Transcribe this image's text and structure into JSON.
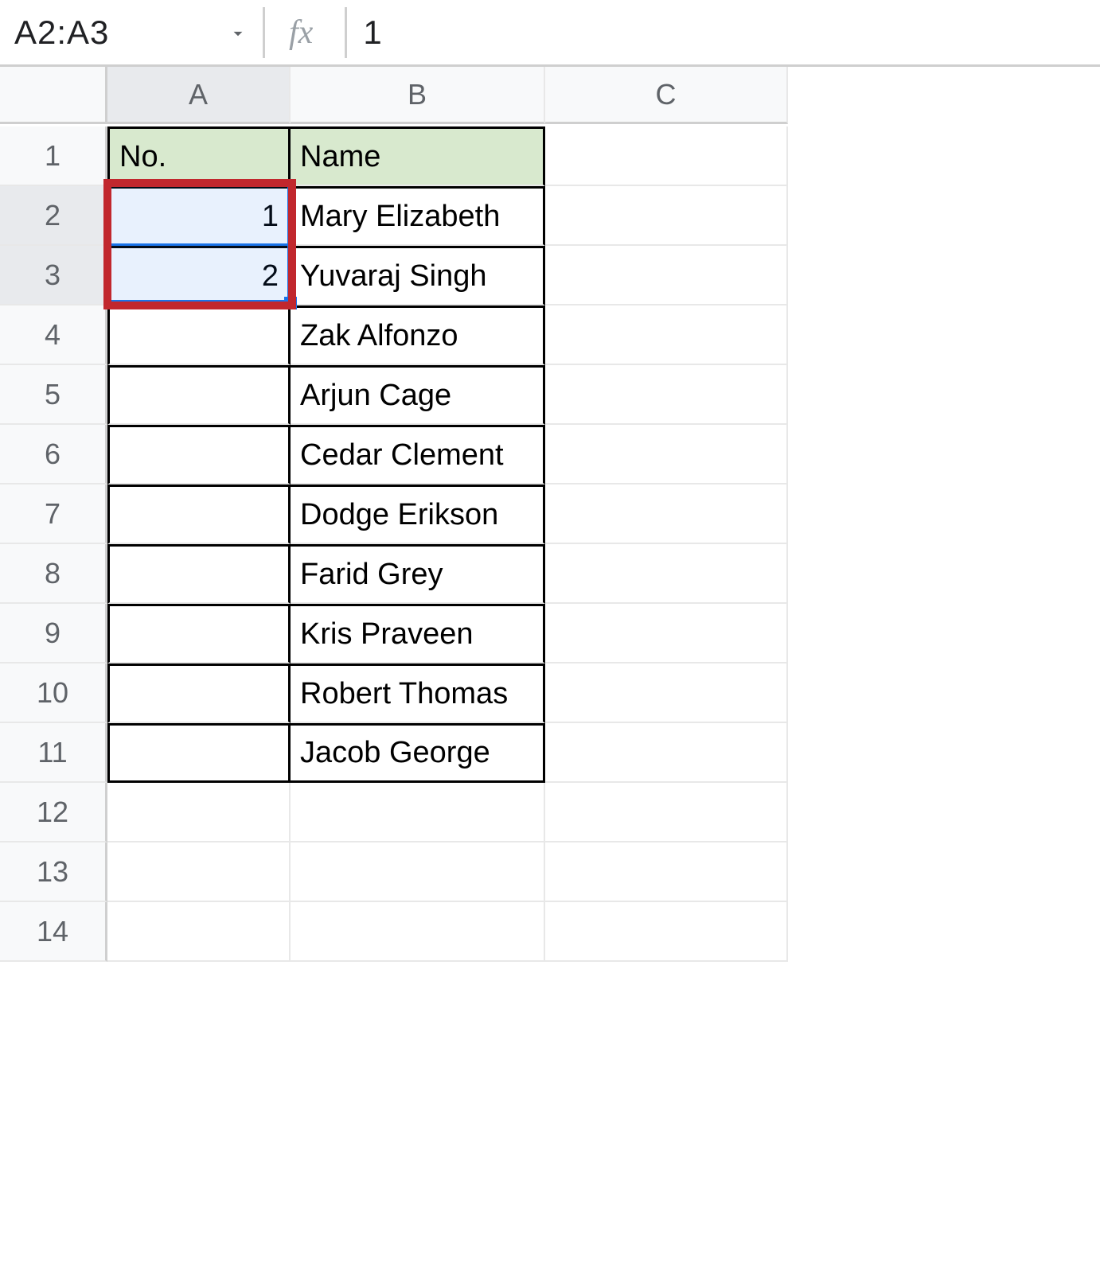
{
  "name_box": "A2:A3",
  "fx_label": "fx",
  "formula_value": "1",
  "columns": [
    "A",
    "B",
    "C"
  ],
  "row_numbers": [
    "1",
    "2",
    "3",
    "4",
    "5",
    "6",
    "7",
    "8",
    "9",
    "10",
    "11",
    "12",
    "13",
    "14"
  ],
  "header": {
    "no": "No.",
    "name": "Name"
  },
  "a_values": {
    "r2": "1",
    "r3": "2"
  },
  "names": {
    "r2": "Mary Elizabeth",
    "r3": "Yuvaraj Singh",
    "r4": "Zak Alfonzo",
    "r5": "Arjun Cage",
    "r6": "Cedar Clement",
    "r7": "Dodge Erikson",
    "r8": "Farid Grey",
    "r9": "Kris Praveen",
    "r10": "Robert Thomas",
    "r11": "Jacob George"
  },
  "selection": "A2:A3",
  "colors": {
    "selection": "#1a73e8",
    "highlight": "#c1272d",
    "header_fill": "#d8e9ce"
  }
}
